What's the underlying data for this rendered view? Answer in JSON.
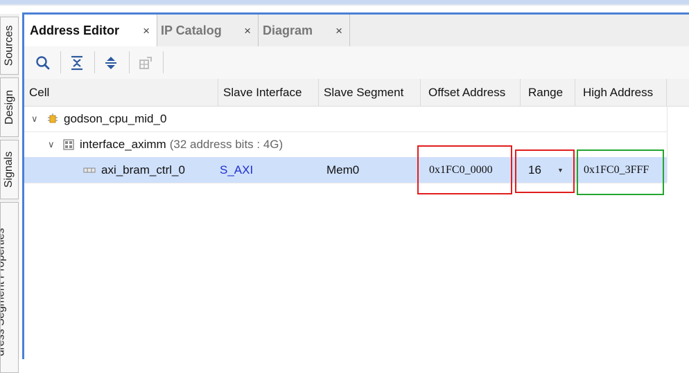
{
  "side_tabs": [
    "Sources",
    "Design",
    "Signals",
    "dress Segment Properties"
  ],
  "tabs": [
    {
      "label": "Address Editor",
      "active": true
    },
    {
      "label": "IP Catalog",
      "active": false
    },
    {
      "label": "Diagram",
      "active": false
    }
  ],
  "icons": {
    "tab_close": "×",
    "toolbar": [
      "search-icon",
      "collapse-all-icon",
      "expand-all-icon",
      "auto-assign-icon"
    ]
  },
  "columns": [
    "Cell",
    "Slave Interface",
    "Slave Segment",
    "Offset Address",
    "Range",
    "High Address"
  ],
  "rows": [
    {
      "cell": "godson_cpu_mid_0"
    },
    {
      "cell": "interface_aximm",
      "note": "(32 address bits : 4G)"
    },
    {
      "cell": "axi_bram_ctrl_0",
      "slave_interface": "S_AXI",
      "slave_segment": "Mem0",
      "offset_address": "0x1FC0_0000",
      "range": "16",
      "high_address": "0x1FC0_3FFF"
    }
  ],
  "colors": {
    "accent": "#4a80d6",
    "selection": "#cfe0fb",
    "annotation_red": "#e21d1d",
    "annotation_green": "#23a62e",
    "link": "#1e2fd0"
  }
}
